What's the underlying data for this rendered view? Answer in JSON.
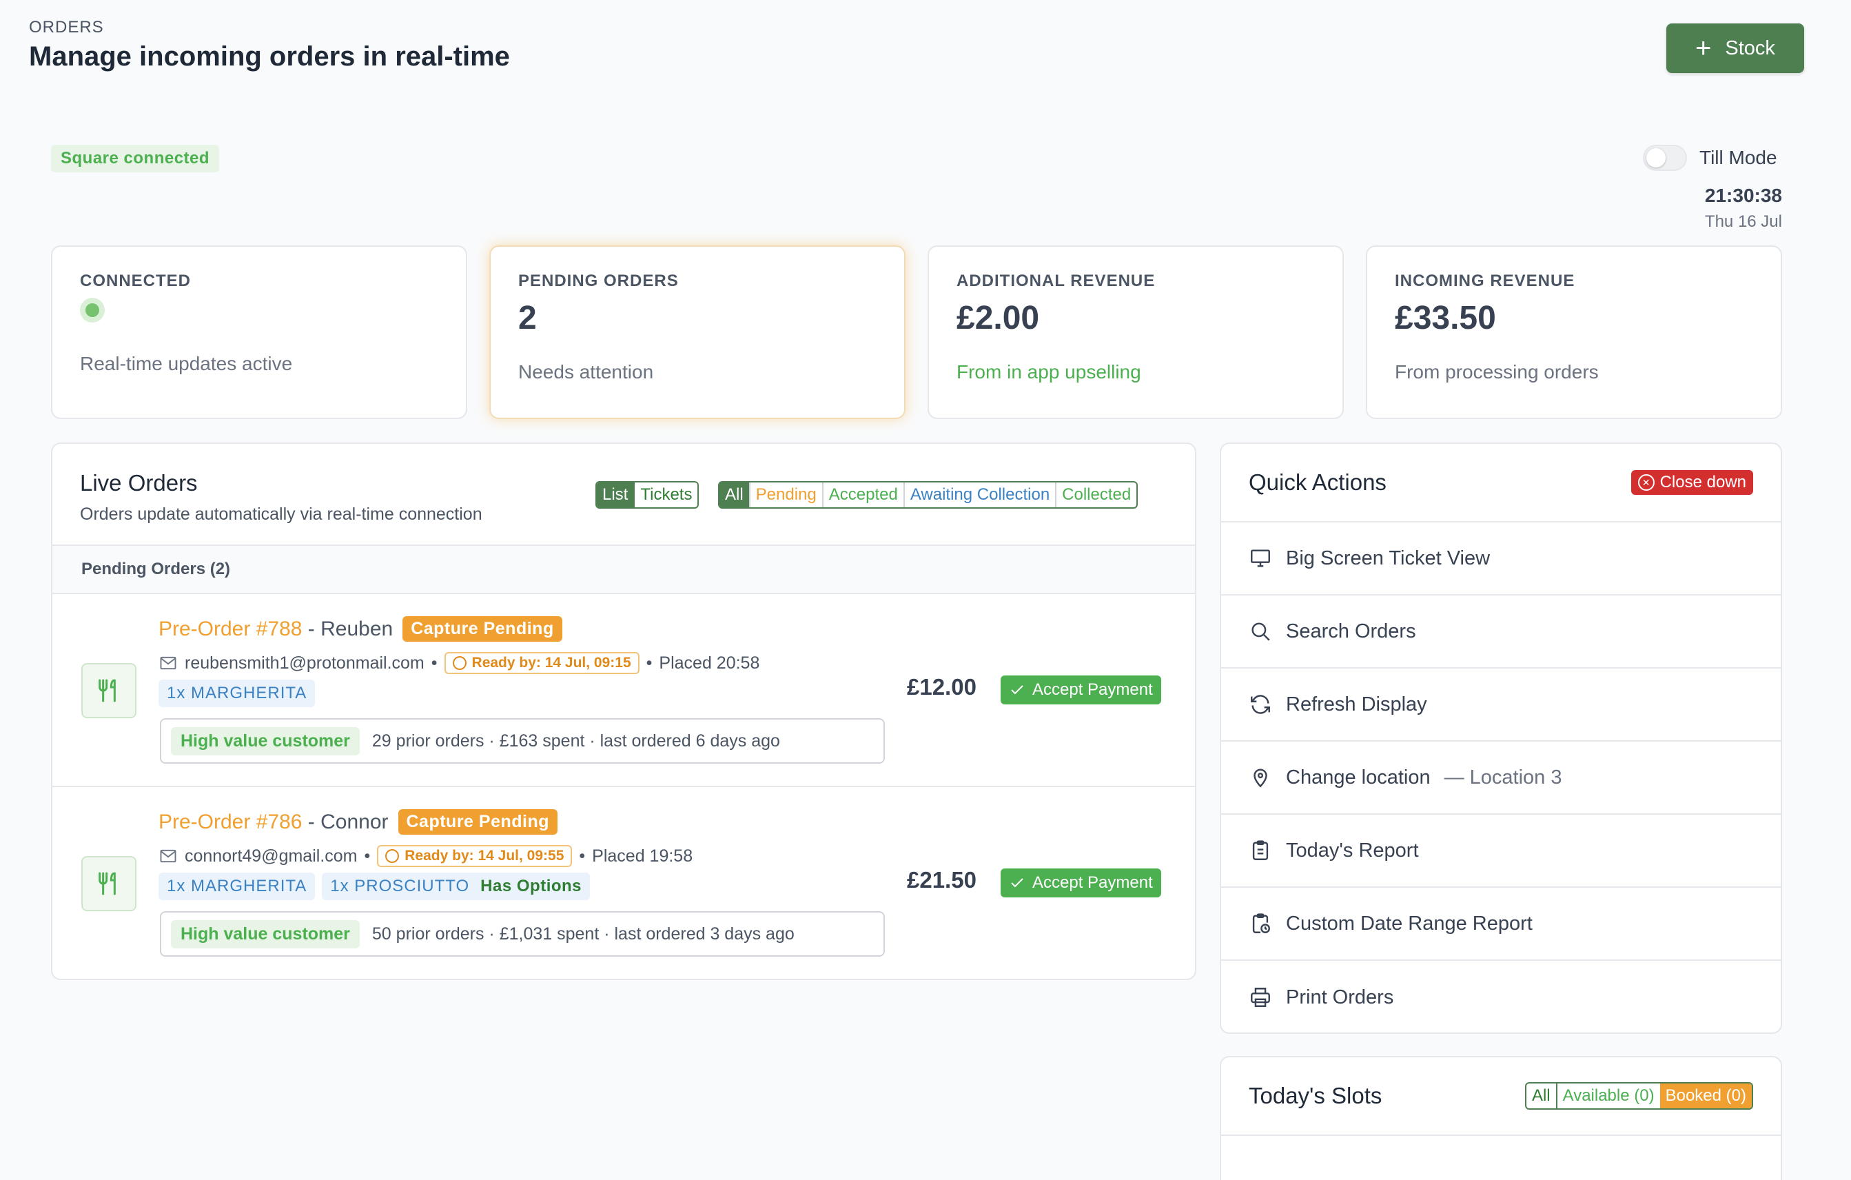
{
  "header": {
    "kicker": "ORDERS",
    "title": "Manage incoming orders in real-time",
    "stock_button": "Stock"
  },
  "status": {
    "square": "Square connected",
    "till_mode": "Till Mode",
    "time": "21:30:38",
    "date": "Thu 16 Jul"
  },
  "stats": [
    {
      "label": "CONNECTED",
      "value": "",
      "sub": "Real-time updates active"
    },
    {
      "label": "PENDING ORDERS",
      "value": "2",
      "sub": "Needs attention"
    },
    {
      "label": "ADDITIONAL REVENUE",
      "value": "£2.00",
      "sub": "From in app upselling"
    },
    {
      "label": "INCOMING REVENUE",
      "value": "£33.50",
      "sub": "From processing orders"
    }
  ],
  "live": {
    "title": "Live Orders",
    "subtitle": "Orders update automatically via real-time connection",
    "view_toggle": [
      "List",
      "Tickets"
    ],
    "filters": [
      "All",
      "Pending",
      "Accepted",
      "Awaiting Collection",
      "Collected"
    ],
    "section": "Pending Orders (2)",
    "orders": [
      {
        "number": "Pre-Order #788",
        "name": "- Reuben",
        "status": "Capture Pending",
        "email": "reubensmith1@protonmail.com",
        "ready": "Ready by: 14 Jul, 09:15",
        "placed": "Placed 20:58",
        "items": [
          "1x MARGHERITA"
        ],
        "customer_tag": "High value customer",
        "customer_info": "29 prior orders · £163 spent · last ordered 6 days ago",
        "price": "£12.00",
        "action": "Accept Payment"
      },
      {
        "number": "Pre-Order #786",
        "name": "- Connor",
        "status": "Capture Pending",
        "email": "connort49@gmail.com",
        "ready": "Ready by: 14 Jul, 09:55",
        "placed": "Placed 19:58",
        "items": [
          "1x MARGHERITA",
          "1x PROSCIUTTO"
        ],
        "item_option": "Has Options",
        "customer_tag": "High value customer",
        "customer_info": "50 prior orders · £1,031 spent · last ordered 3 days ago",
        "price": "£21.50",
        "action": "Accept Payment"
      }
    ]
  },
  "quick_actions": {
    "title": "Quick Actions",
    "close_down": "Close down",
    "items": [
      {
        "label": "Big Screen Ticket View",
        "icon": "monitor-icon"
      },
      {
        "label": "Search Orders",
        "icon": "search-icon"
      },
      {
        "label": "Refresh Display",
        "icon": "refresh-icon"
      },
      {
        "label": "Change location",
        "extra": "— Location 3",
        "icon": "map-pin-icon"
      },
      {
        "label": "Today's Report",
        "icon": "clipboard-icon"
      },
      {
        "label": "Custom Date Range Report",
        "icon": "calendar-clipboard-icon"
      },
      {
        "label": "Print Orders",
        "icon": "printer-icon"
      }
    ]
  },
  "slots": {
    "title": "Today's Slots",
    "filters": [
      "All",
      "Available (0)",
      "Booked (0)"
    ]
  },
  "colors": {
    "brand": "#4e7f51",
    "pending": "#f0a030",
    "success": "#4caf50",
    "info": "#3b82c4",
    "danger": "#d32f2f"
  }
}
